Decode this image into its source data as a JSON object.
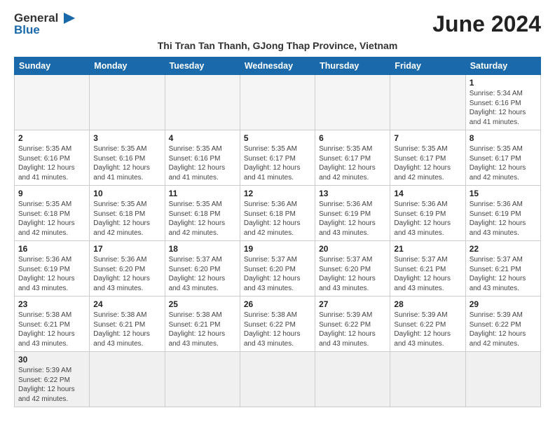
{
  "header": {
    "logo_general": "General",
    "logo_blue": "Blue",
    "month_title": "June 2024",
    "subtitle": "Thi Tran Tan Thanh, GJong Thap Province, Vietnam"
  },
  "days_of_week": [
    "Sunday",
    "Monday",
    "Tuesday",
    "Wednesday",
    "Thursday",
    "Friday",
    "Saturday"
  ],
  "weeks": [
    [
      {
        "day": null,
        "info": null
      },
      {
        "day": null,
        "info": null
      },
      {
        "day": null,
        "info": null
      },
      {
        "day": null,
        "info": null
      },
      {
        "day": null,
        "info": null
      },
      {
        "day": null,
        "info": null
      },
      {
        "day": "1",
        "info": "Sunrise: 5:34 AM\nSunset: 6:16 PM\nDaylight: 12 hours and 41 minutes."
      }
    ],
    [
      {
        "day": "2",
        "info": "Sunrise: 5:35 AM\nSunset: 6:16 PM\nDaylight: 12 hours and 41 minutes."
      },
      {
        "day": "3",
        "info": "Sunrise: 5:35 AM\nSunset: 6:16 PM\nDaylight: 12 hours and 41 minutes."
      },
      {
        "day": "4",
        "info": "Sunrise: 5:35 AM\nSunset: 6:16 PM\nDaylight: 12 hours and 41 minutes."
      },
      {
        "day": "5",
        "info": "Sunrise: 5:35 AM\nSunset: 6:17 PM\nDaylight: 12 hours and 41 minutes."
      },
      {
        "day": "6",
        "info": "Sunrise: 5:35 AM\nSunset: 6:17 PM\nDaylight: 12 hours and 42 minutes."
      },
      {
        "day": "7",
        "info": "Sunrise: 5:35 AM\nSunset: 6:17 PM\nDaylight: 12 hours and 42 minutes."
      },
      {
        "day": "8",
        "info": "Sunrise: 5:35 AM\nSunset: 6:17 PM\nDaylight: 12 hours and 42 minutes."
      }
    ],
    [
      {
        "day": "9",
        "info": "Sunrise: 5:35 AM\nSunset: 6:18 PM\nDaylight: 12 hours and 42 minutes."
      },
      {
        "day": "10",
        "info": "Sunrise: 5:35 AM\nSunset: 6:18 PM\nDaylight: 12 hours and 42 minutes."
      },
      {
        "day": "11",
        "info": "Sunrise: 5:35 AM\nSunset: 6:18 PM\nDaylight: 12 hours and 42 minutes."
      },
      {
        "day": "12",
        "info": "Sunrise: 5:36 AM\nSunset: 6:18 PM\nDaylight: 12 hours and 42 minutes."
      },
      {
        "day": "13",
        "info": "Sunrise: 5:36 AM\nSunset: 6:19 PM\nDaylight: 12 hours and 43 minutes."
      },
      {
        "day": "14",
        "info": "Sunrise: 5:36 AM\nSunset: 6:19 PM\nDaylight: 12 hours and 43 minutes."
      },
      {
        "day": "15",
        "info": "Sunrise: 5:36 AM\nSunset: 6:19 PM\nDaylight: 12 hours and 43 minutes."
      }
    ],
    [
      {
        "day": "16",
        "info": "Sunrise: 5:36 AM\nSunset: 6:19 PM\nDaylight: 12 hours and 43 minutes."
      },
      {
        "day": "17",
        "info": "Sunrise: 5:36 AM\nSunset: 6:20 PM\nDaylight: 12 hours and 43 minutes."
      },
      {
        "day": "18",
        "info": "Sunrise: 5:37 AM\nSunset: 6:20 PM\nDaylight: 12 hours and 43 minutes."
      },
      {
        "day": "19",
        "info": "Sunrise: 5:37 AM\nSunset: 6:20 PM\nDaylight: 12 hours and 43 minutes."
      },
      {
        "day": "20",
        "info": "Sunrise: 5:37 AM\nSunset: 6:20 PM\nDaylight: 12 hours and 43 minutes."
      },
      {
        "day": "21",
        "info": "Sunrise: 5:37 AM\nSunset: 6:21 PM\nDaylight: 12 hours and 43 minutes."
      },
      {
        "day": "22",
        "info": "Sunrise: 5:37 AM\nSunset: 6:21 PM\nDaylight: 12 hours and 43 minutes."
      }
    ],
    [
      {
        "day": "23",
        "info": "Sunrise: 5:38 AM\nSunset: 6:21 PM\nDaylight: 12 hours and 43 minutes."
      },
      {
        "day": "24",
        "info": "Sunrise: 5:38 AM\nSunset: 6:21 PM\nDaylight: 12 hours and 43 minutes."
      },
      {
        "day": "25",
        "info": "Sunrise: 5:38 AM\nSunset: 6:21 PM\nDaylight: 12 hours and 43 minutes."
      },
      {
        "day": "26",
        "info": "Sunrise: 5:38 AM\nSunset: 6:22 PM\nDaylight: 12 hours and 43 minutes."
      },
      {
        "day": "27",
        "info": "Sunrise: 5:39 AM\nSunset: 6:22 PM\nDaylight: 12 hours and 43 minutes."
      },
      {
        "day": "28",
        "info": "Sunrise: 5:39 AM\nSunset: 6:22 PM\nDaylight: 12 hours and 43 minutes."
      },
      {
        "day": "29",
        "info": "Sunrise: 5:39 AM\nSunset: 6:22 PM\nDaylight: 12 hours and 42 minutes."
      }
    ],
    [
      {
        "day": "30",
        "info": "Sunrise: 5:39 AM\nSunset: 6:22 PM\nDaylight: 12 hours and 42 minutes."
      },
      {
        "day": null,
        "info": null
      },
      {
        "day": null,
        "info": null
      },
      {
        "day": null,
        "info": null
      },
      {
        "day": null,
        "info": null
      },
      {
        "day": null,
        "info": null
      },
      {
        "day": null,
        "info": null
      }
    ]
  ]
}
